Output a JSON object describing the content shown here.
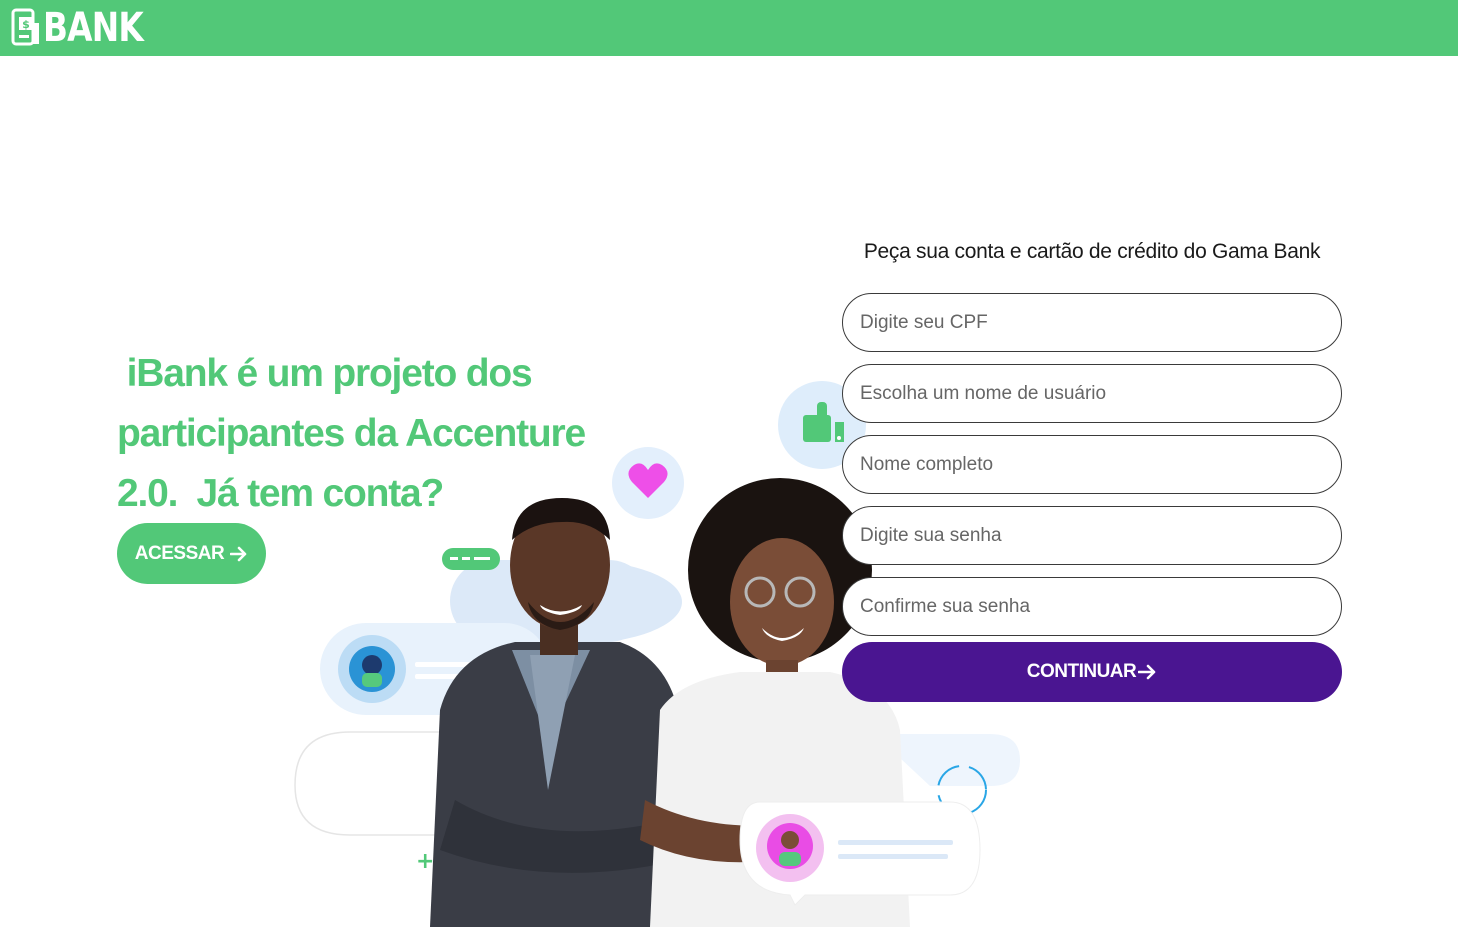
{
  "header": {
    "logo_text": "BANK",
    "brand_color": "#52c878"
  },
  "hero": {
    "line1": "iBank é um projeto dos",
    "line2": "participantes da Accenture",
    "line3": "2.0.  Já tem conta?",
    "access_button": "ACESSAR",
    "access_icon": "arrow-right-icon"
  },
  "form": {
    "title": "Peça sua conta e cartão de crédito do Gama Bank",
    "cpf_placeholder": "Digite seu CPF",
    "username_placeholder": "Escolha um nome de usuário",
    "fullname_placeholder": "Nome completo",
    "password_placeholder": "Digite sua senha",
    "confirm_placeholder": "Confirme sua senha",
    "submit_label": "CONTINUAR",
    "submit_icon": "arrow-right-icon",
    "submit_color": "#4a1591"
  }
}
